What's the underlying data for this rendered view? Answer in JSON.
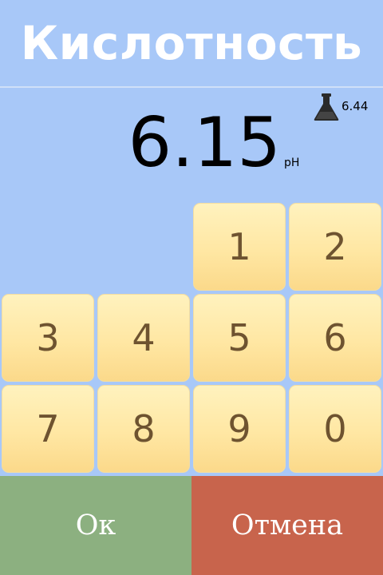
{
  "screen": {
    "title": "Кислотность",
    "reading": "6.15",
    "unit": "pH",
    "reference_icon": "flask-icon",
    "reference_value": "6.44"
  },
  "keypad": {
    "k1": "1",
    "k2": "2",
    "k3": "3",
    "k4": "4",
    "k5": "5",
    "k6": "6",
    "k7": "7",
    "k8": "8",
    "k9": "9",
    "k0": "0"
  },
  "actions": {
    "ok_label": "Ок",
    "cancel_label": "Отмена"
  },
  "colors": {
    "background": "#a8c8f8",
    "key": "#ffe7a3",
    "key_text": "#6e5330",
    "ok": "#8cb080",
    "cancel": "#c8644c"
  }
}
